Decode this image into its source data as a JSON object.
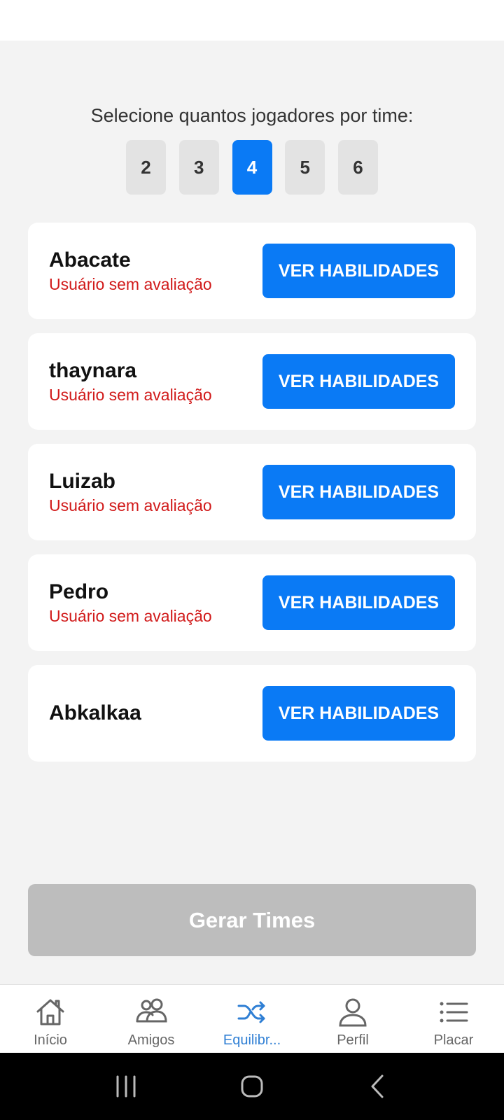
{
  "selector": {
    "label": "Selecione quantos jogadores por time:",
    "options": [
      "2",
      "3",
      "4",
      "5",
      "6"
    ],
    "selected": "4"
  },
  "players": [
    {
      "name": "Abacate",
      "status": "Usuário sem avaliação",
      "button": "VER HABILIDADES"
    },
    {
      "name": "thaynara",
      "status": "Usuário sem avaliação",
      "button": "VER HABILIDADES"
    },
    {
      "name": "Luizab",
      "status": "Usuário sem avaliação",
      "button": "VER HABILIDADES"
    },
    {
      "name": "Pedro",
      "status": "Usuário sem avaliação",
      "button": "VER HABILIDADES"
    },
    {
      "name": "Abkalkaa",
      "status": "",
      "button": "VER HABILIDADES"
    }
  ],
  "generate_button": "Gerar Times",
  "nav": {
    "items": [
      {
        "label": "Início",
        "icon": "home-icon"
      },
      {
        "label": "Amigos",
        "icon": "friends-icon"
      },
      {
        "label": "Equilibr...",
        "icon": "shuffle-icon"
      },
      {
        "label": "Perfil",
        "icon": "profile-icon"
      },
      {
        "label": "Placar",
        "icon": "list-icon"
      }
    ],
    "active_index": 2
  },
  "colors": {
    "accent": "#0a7af5",
    "nav_active": "#2f7fd4",
    "warning_text": "#d11a1a",
    "disabled_button": "#bdbdbd"
  }
}
